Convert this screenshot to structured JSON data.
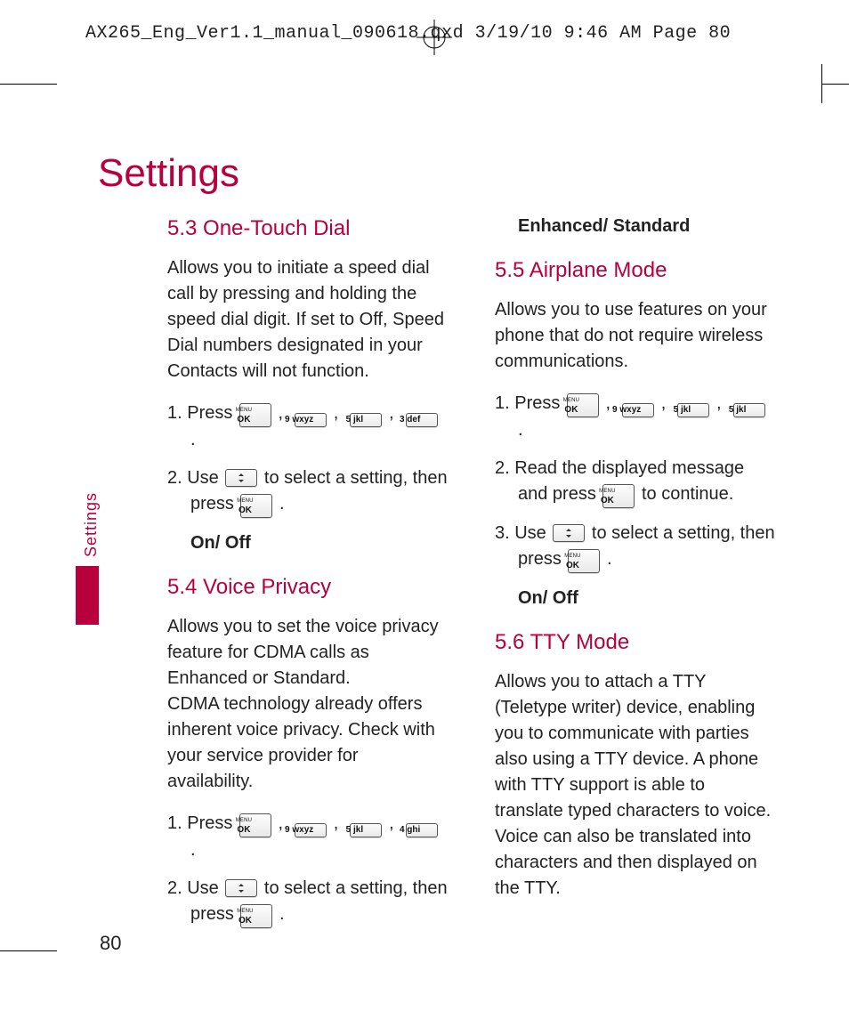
{
  "slug": "AX265_Eng_Ver1.1_manual_090618.qxd  3/19/10  9:46 AM  Page 80",
  "page_title": "Settings",
  "sidebar_label": "Settings",
  "page_number": "80",
  "keys": {
    "menu_top": "MENU",
    "menu_ok": "OK",
    "k9": "9 wxyz",
    "k5": "5 jkl",
    "k3": "3 def",
    "k4": "4 ghi"
  },
  "sec53": {
    "heading": "5.3 One-Touch Dial",
    "intro": "Allows you to initiate a speed dial call by pressing and holding the speed dial digit. If set to Off, Speed Dial numbers designated in your Contacts will not function.",
    "step1_a": "1. Press ",
    "step2_a": "2. Use ",
    "step2_b": " to select a setting, then press ",
    "options": "On/ Off"
  },
  "sec54": {
    "heading": "5.4 Voice Privacy",
    "intro": "Allows you to set the voice privacy feature for CDMA calls as Enhanced or Standard.\nCDMA technology already offers inherent voice privacy. Check with your service provider for availability.",
    "step1_a": "1. Press ",
    "step2_a": "2. Use ",
    "step2_b": " to select a setting, then press "
  },
  "col2_top": "Enhanced/ Standard",
  "sec55": {
    "heading": "5.5 Airplane Mode",
    "intro": "Allows you to use features on your phone that do not require wireless communications.",
    "step1_a": "1. Press ",
    "step2_a": "2. Read the displayed message and press ",
    "step2_b": " to continue.",
    "step3_a": "3. Use ",
    "step3_b": " to select a setting, then press ",
    "options": "On/ Off"
  },
  "sec56": {
    "heading": "5.6 TTY Mode",
    "intro": "Allows you to attach a TTY (Teletype writer) device, enabling you to communicate with parties also using a TTY device. A phone with TTY support is able to translate typed characters to voice. Voice can also be translated into characters and then displayed on the TTY."
  }
}
